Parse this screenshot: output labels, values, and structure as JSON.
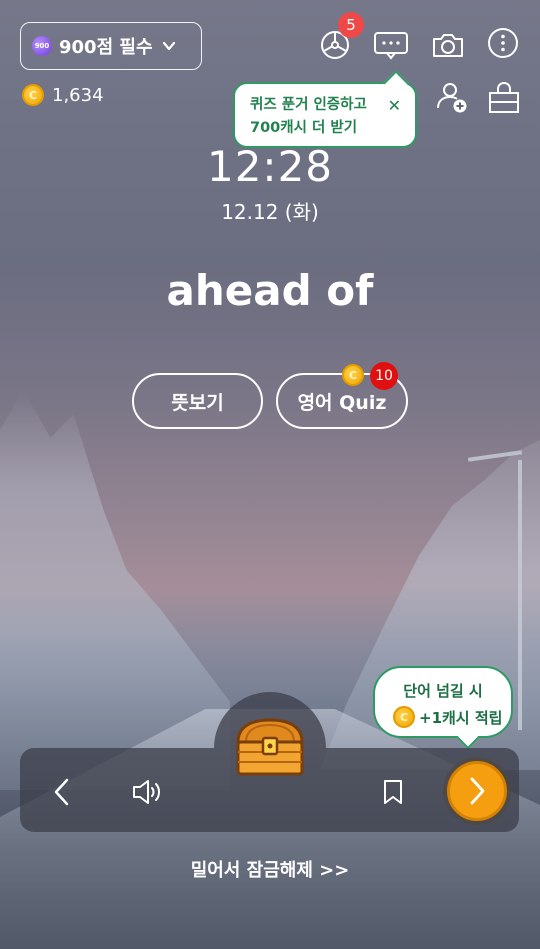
{
  "header": {
    "level_badge": "900",
    "level_label": "900점 필수",
    "coin_balance": "1,634",
    "notification_count": "5"
  },
  "tooltip_cash": {
    "line1": "퀴즈 푼거 인증하고",
    "line2": "700캐시 더 받기",
    "close": "✕"
  },
  "clock": {
    "time": "12:28",
    "date": "12.12 (화)"
  },
  "word": "ahead of",
  "actions": {
    "meaning_label": "뜻보기",
    "quiz_label": "영어 Quiz",
    "quiz_badge": "10"
  },
  "reward_tooltip": {
    "line1": "단어 넘길 시",
    "line2": "+1캐시 적립"
  },
  "footer": {
    "unlock_label": "밀어서 잠금해제 >>"
  },
  "colors": {
    "accent_green": "#2d9a63",
    "next_orange": "#f59e10",
    "badge_red": "#ef4848"
  }
}
